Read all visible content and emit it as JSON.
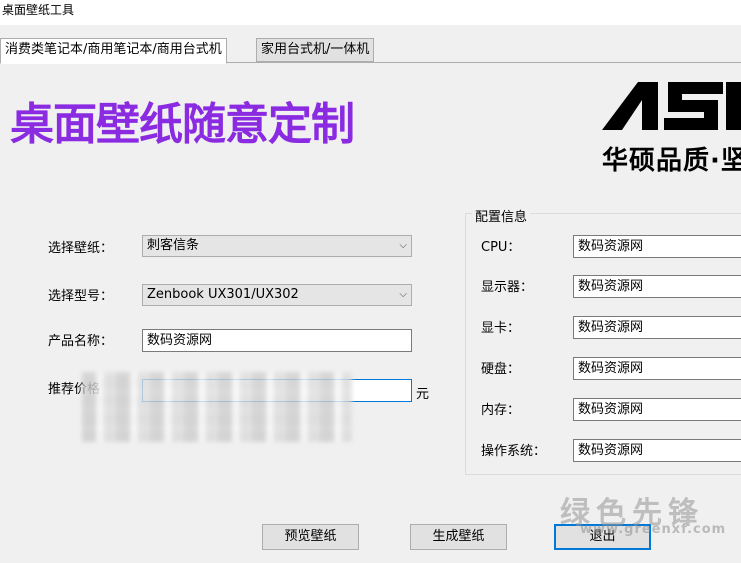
{
  "window": {
    "title": "桌面壁纸工具"
  },
  "tabs": [
    {
      "label": "消费类笔记本/商用笔记本/商用台式机",
      "active": true
    },
    {
      "label": "家用台式机/一体机",
      "active": false
    }
  ],
  "banner": {
    "text": "桌面壁纸随意定制",
    "color": "#8a2be2"
  },
  "logo": {
    "brand": "ASUS",
    "slogan": "华硕品质·坚"
  },
  "form": {
    "wallpaper_label": "选择壁纸：",
    "wallpaper_value": "刺客信条",
    "model_label": "选择型号：",
    "model_value": "Zenbook UX301/UX302",
    "product_label": "产品名称：",
    "product_value": "数码资源网",
    "price_label": "推荐价格",
    "price_unit": "元"
  },
  "config": {
    "title": "配置信息",
    "rows": [
      {
        "label": "CPU：",
        "value": "数码资源网"
      },
      {
        "label": "显示器：",
        "value": "数码资源网"
      },
      {
        "label": "显卡：",
        "value": "数码资源网"
      },
      {
        "label": "硬盘：",
        "value": "数码资源网"
      },
      {
        "label": "内存：",
        "value": "数码资源网"
      },
      {
        "label": "操作系统：",
        "value": "数码资源网"
      }
    ]
  },
  "buttons": {
    "preview": "预览壁纸",
    "generate": "生成壁纸",
    "exit": "退出"
  },
  "watermark": {
    "text": "绿色先锋",
    "url": "www.greenxf.com"
  }
}
